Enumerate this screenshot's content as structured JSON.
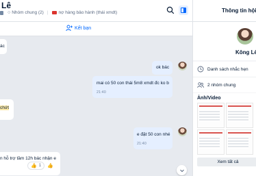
{
  "chat": {
    "contact_name": "Lê",
    "group_label": "Nhóm chung (2)",
    "tag_label": "nợ hàng bảo hành (thái xmdt)",
    "add_friend": "Kết bạn"
  },
  "messages": [
    {
      "text": "ác",
      "time": ""
    },
    {
      "text": "ok bác",
      "time": ""
    },
    {
      "text": "mai có 50 con thái 5m8 xmdt đc ko b",
      "time": "21:40"
    },
    {
      "text": "chứt",
      "time": ""
    },
    {
      "text": "e đặt 50 con nhé",
      "time": "21:40"
    },
    {
      "text": "n hỗ trợ tầm 12h bác nhận e",
      "time": ""
    }
  ],
  "reactions": {
    "count": "1"
  },
  "panel": {
    "title": "Thông tin hội",
    "profile_name": "Kông Lê",
    "reminders": "Danh sách nhắc hẹn",
    "common_groups": "2 nhóm chung",
    "media_title": "Ảnh/Video",
    "see_all": "Xem tất cả"
  },
  "colors": {
    "accent": "#0068ff",
    "my_bubble": "#e5efff",
    "chat_bg": "#e7eaef",
    "tag": "#db342e"
  }
}
